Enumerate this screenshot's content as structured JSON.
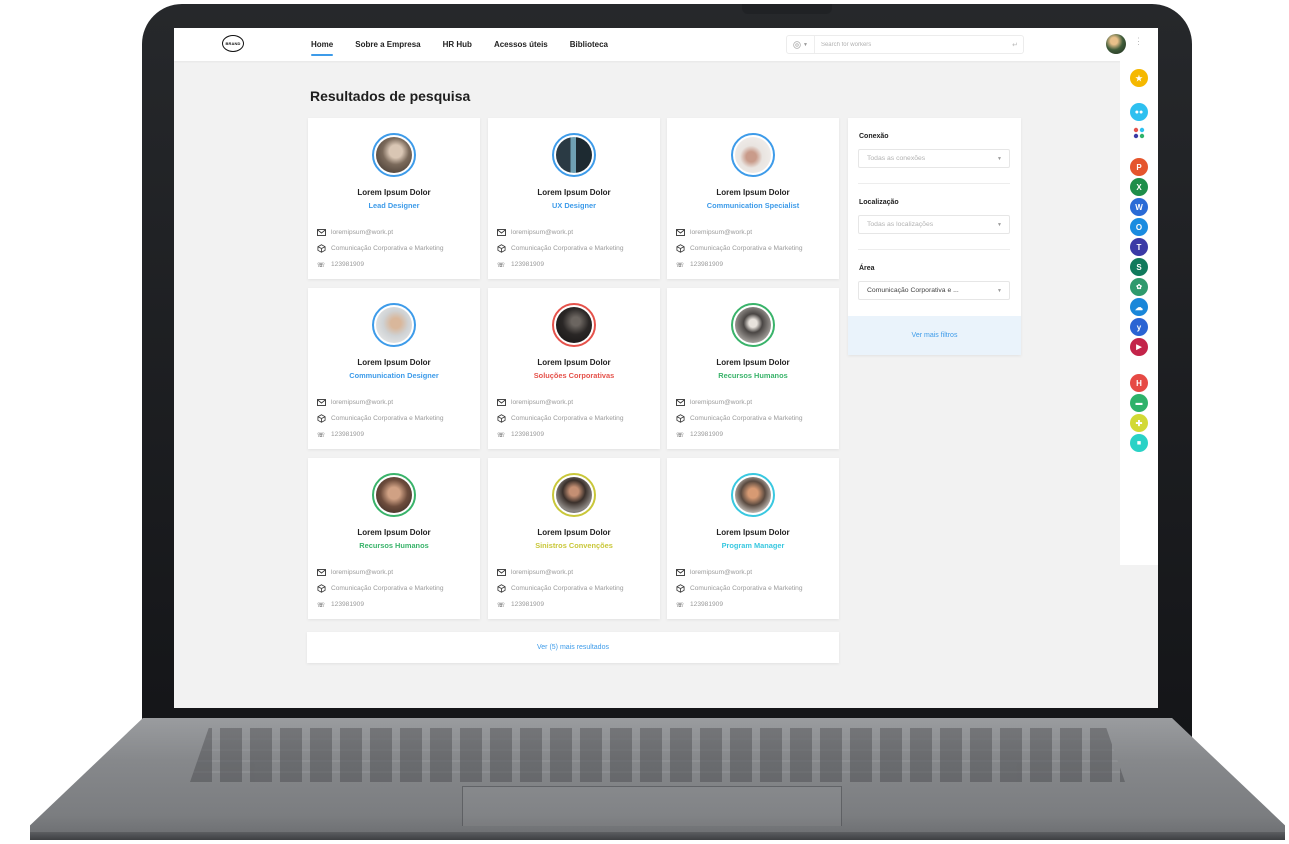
{
  "nav": {
    "logo_text": "BRAND",
    "items": [
      {
        "label": "Home",
        "active": true
      },
      {
        "label": "Sobre a Empresa",
        "active": false
      },
      {
        "label": "HR Hub",
        "active": false
      },
      {
        "label": "Acessos úteis",
        "active": false
      },
      {
        "label": "Biblioteca",
        "active": false
      }
    ]
  },
  "search": {
    "placeholder": "Search for workers",
    "filter_icon": "at-sign-icon",
    "submit_icon": "enter-icon"
  },
  "page": {
    "title": "Resultados de pesquisa",
    "more_results_label": "Ver (5) mais resultados"
  },
  "colors": {
    "accent": "#3d9be9",
    "red": "#e5524b",
    "green": "#39b36a",
    "yellow": "#c9c73a",
    "cyan": "#39c8e0"
  },
  "cards": [
    {
      "name": "Lorem Ipsum Dolor",
      "role": "Lead Designer",
      "role_color": "#3d9be9",
      "email": "loremipsum@work.pt",
      "department": "Comunicação Corporativa e Marketing",
      "phone": "123981909"
    },
    {
      "name": "Lorem Ipsum Dolor",
      "role": "UX Designer",
      "role_color": "#3d9be9",
      "email": "loremipsum@work.pt",
      "department": "Comunicação Corporativa e Marketing",
      "phone": "123981909"
    },
    {
      "name": "Lorem Ipsum Dolor",
      "role": "Communication Specialist",
      "role_color": "#3d9be9",
      "email": "loremipsum@work.pt",
      "department": "Comunicação Corporativa e Marketing",
      "phone": "123981909"
    },
    {
      "name": "Lorem Ipsum Dolor",
      "role": "Communication Designer",
      "role_color": "#3d9be9",
      "email": "loremipsum@work.pt",
      "department": "Comunicação Corporativa e Marketing",
      "phone": "123981909"
    },
    {
      "name": "Lorem Ipsum Dolor",
      "role": "Soluções Corporativas",
      "role_color": "#e5524b",
      "email": "loremipsum@work.pt",
      "department": "Comunicação Corporativa e Marketing",
      "phone": "123981909"
    },
    {
      "name": "Lorem Ipsum Dolor",
      "role": "Recursos Humanos",
      "role_color": "#39b36a",
      "email": "loremipsum@work.pt",
      "department": "Comunicação Corporativa e Marketing",
      "phone": "123981909"
    },
    {
      "name": "Lorem Ipsum Dolor",
      "role": "Recursos Humanos",
      "role_color": "#39b36a",
      "email": "loremipsum@work.pt",
      "department": "Comunicação Corporativa e Marketing",
      "phone": "123981909"
    },
    {
      "name": "Lorem Ipsum Dolor",
      "role": "Sinistros Convenções",
      "role_color": "#c9c73a",
      "email": "loremipsum@work.pt",
      "department": "Comunicação Corporativa e Marketing",
      "phone": "123981909"
    },
    {
      "name": "Lorem Ipsum Dolor",
      "role": "Program Manager",
      "role_color": "#39c8e0",
      "email": "loremipsum@work.pt",
      "department": "Comunicação Corporativa e Marketing",
      "phone": "123981909"
    }
  ],
  "filters": {
    "connection": {
      "label": "Conexão",
      "value": "Todas as conexões"
    },
    "location": {
      "label": "Localização",
      "value": "Todas as localizações"
    },
    "area": {
      "label": "Área",
      "value": "Comunicação Corporativa e ..."
    },
    "more_label": "Ver mais filtros"
  },
  "apps": [
    {
      "icon": "star-icon",
      "color": "#f5b800",
      "glyph": "★"
    },
    {
      "icon": "teams-icon",
      "color": "#2ec0f0",
      "glyph": "👥"
    },
    {
      "icon": "apps-grid-icon",
      "color": "#ffffff",
      "glyph": ""
    },
    {
      "icon": "powerpoint-icon",
      "color": "#e5552d",
      "glyph": "P"
    },
    {
      "icon": "excel-icon",
      "color": "#1e8e4a",
      "glyph": "X"
    },
    {
      "icon": "word-icon",
      "color": "#2a6bd6",
      "glyph": "W"
    },
    {
      "icon": "outlook-icon",
      "color": "#1a8ce0",
      "glyph": "O"
    },
    {
      "icon": "teams-chat-icon",
      "color": "#3b3aa6",
      "glyph": "T"
    },
    {
      "icon": "sharepoint-icon",
      "color": "#117a5c",
      "glyph": "S"
    },
    {
      "icon": "people-icon",
      "color": "#2f9a6d",
      "glyph": "👥"
    },
    {
      "icon": "onedrive-icon",
      "color": "#1a87d9",
      "glyph": "☁"
    },
    {
      "icon": "yammer-icon",
      "color": "#2b64d3",
      "glyph": "y"
    },
    {
      "icon": "stream-icon",
      "color": "#c3244a",
      "glyph": "▶"
    },
    {
      "icon": "hr-hub-icon",
      "color": "#e64a45",
      "glyph": "H"
    },
    {
      "icon": "car-icon",
      "color": "#2fb26a",
      "glyph": "🚗"
    },
    {
      "icon": "support-icon",
      "color": "#d2d935",
      "glyph": "✚"
    },
    {
      "icon": "chat-icon",
      "color": "#2ad2c6",
      "glyph": "💬"
    }
  ]
}
